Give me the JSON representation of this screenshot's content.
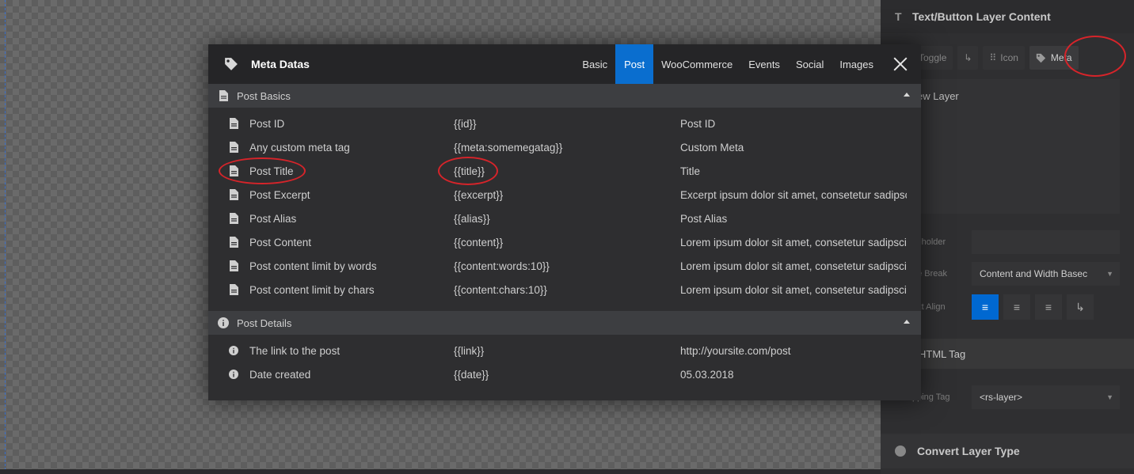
{
  "modal": {
    "title": "Meta Datas",
    "tabs": [
      "Basic",
      "Post",
      "WooCommerce",
      "Events",
      "Social",
      "Images"
    ],
    "active_tab": "Post",
    "groups": [
      {
        "label": "Post Basics",
        "icon": "document-icon",
        "rows": [
          {
            "name": "Post ID",
            "tag": "{{id}}",
            "value": "Post ID"
          },
          {
            "name": "Any custom meta tag",
            "tag": "{{meta:somemegatag}}",
            "value": "Custom Meta"
          },
          {
            "name": "Post Title",
            "tag": "{{title}}",
            "value": "Title"
          },
          {
            "name": "Post Excerpt",
            "tag": "{{excerpt}}",
            "value": "Excerpt ipsum dolor sit amet, consetetur sadipscing"
          },
          {
            "name": "Post Alias",
            "tag": "{{alias}}",
            "value": "Post Alias"
          },
          {
            "name": "Post Content",
            "tag": "{{content}}",
            "value": "Lorem ipsum dolor sit amet, consetetur sadipscing"
          },
          {
            "name": "Post content limit by words",
            "tag": "{{content:words:10}}",
            "value": "Lorem ipsum dolor sit amet, consetetur sadipscing"
          },
          {
            "name": "Post content limit by chars",
            "tag": "{{content:chars:10}}",
            "value": "Lorem ipsum dolor sit amet, consetetur sadipscing"
          }
        ]
      },
      {
        "label": "Post Details",
        "icon": "info-icon",
        "rows": [
          {
            "name": "The link to the post",
            "tag": "{{link}}",
            "value": "http://yoursite.com/post"
          },
          {
            "name": "Date created",
            "tag": "{{date}}",
            "value": "05.03.2018"
          }
        ]
      }
    ]
  },
  "panel": {
    "header_title": "Text/Button Layer Content",
    "tools": {
      "toggle": "Toggle",
      "icon": "Icon",
      "meta": "Meta"
    },
    "layer_text": "ew Layer",
    "placeholder_label": "ceholder",
    "line_break_label": "ne Break",
    "line_break_value": "Content and Width Basec",
    "text_align_label": "ext Align",
    "html_tag_title": "HTML Tag",
    "wrapping_tag_label": "pping Tag",
    "wrapping_tag_value": "<rs-layer>",
    "convert_title": "Convert Layer Type"
  },
  "colors": {
    "accent": "#0a6ecf",
    "annotation": "#d6242a"
  }
}
